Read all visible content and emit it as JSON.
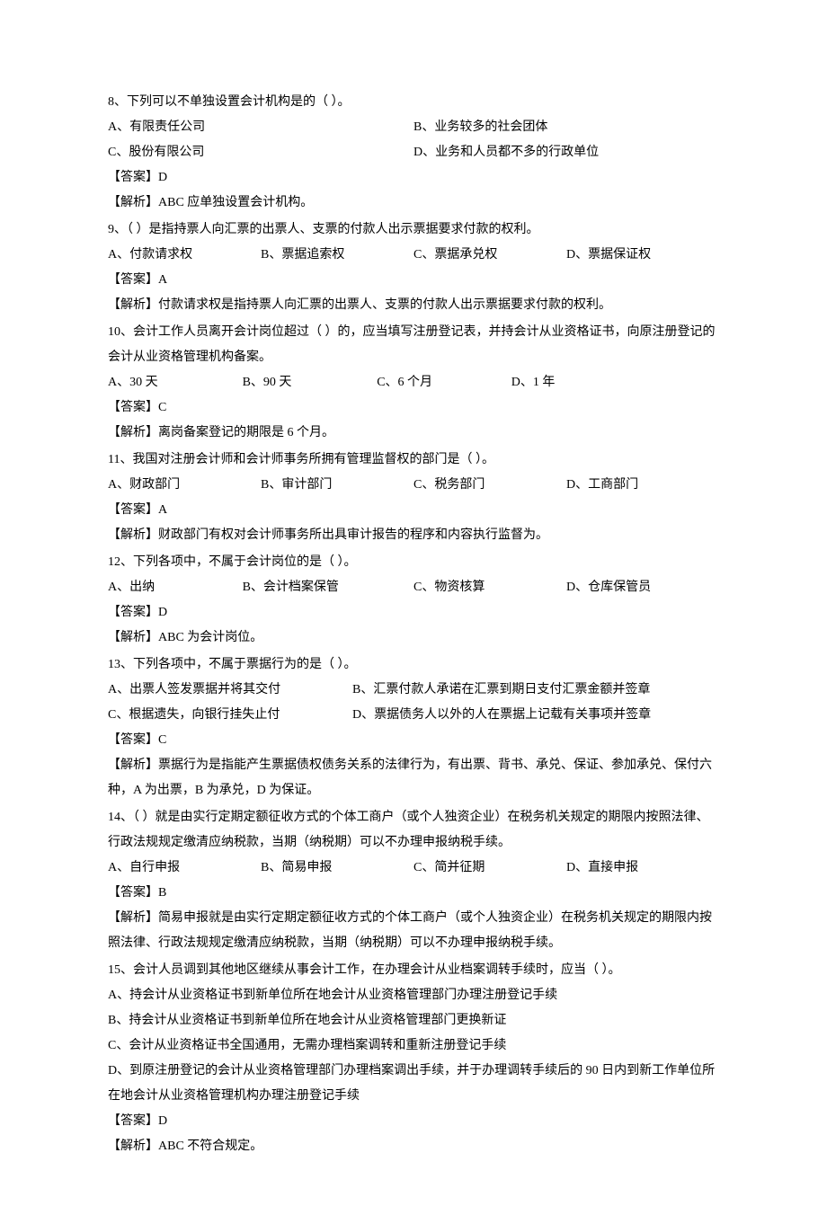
{
  "questions": [
    {
      "num": "8、",
      "text": "下列可以不单独设置会计机构是的（       ）。",
      "options": {
        "A": "A、有限责任公司",
        "B": "B、业务较多的社会团体",
        "C": "C、股份有限公司",
        "D": "D、业务和人员都不多的行政单位"
      },
      "answer": "【答案】D",
      "explain": "【解析】ABC 应单独设置会计机构。"
    },
    {
      "num": "9、",
      "text": "（       ）是指持票人向汇票的出票人、支票的付款人出示票据要求付款的权利。",
      "options": {
        "A": "A、付款请求权",
        "B": "B、票据追索权",
        "C": "C、票据承兑权",
        "D": "D、票据保证权"
      },
      "answer": "【答案】A",
      "explain": "【解析】付款请求权是指持票人向汇票的出票人、支票的付款人出示票据要求付款的权利。"
    },
    {
      "num": "10、",
      "text": "会计工作人员离开会计岗位超过（       ）的，应当填写注册登记表，并持会计从业资格证书，向原注册登记的会计从业资格管理机构备案。",
      "options": {
        "A": "A、30 天",
        "B": "B、90 天",
        "C": "C、6 个月",
        "D": "D、1 年"
      },
      "answer": "【答案】C",
      "explain": "【解析】离岗备案登记的期限是 6 个月。"
    },
    {
      "num": "11、",
      "text": "我国对注册会计师和会计师事务所拥有管理监督权的部门是（       ）。",
      "options": {
        "A": "A、财政部门",
        "B": "B、审计部门",
        "C": "C、税务部门",
        "D": "D、工商部门"
      },
      "answer": "【答案】A",
      "explain": "【解析】财政部门有权对会计师事务所出具审计报告的程序和内容执行监督为。"
    },
    {
      "num": "12、",
      "text": "下列各项中，不属于会计岗位的是（       ）。",
      "options": {
        "A": "A、出纳",
        "B": "B、会计档案保管",
        "C": "C、物资核算",
        "D": "D、仓库保管员"
      },
      "answer": "【答案】D",
      "explain": "【解析】ABC 为会计岗位。"
    },
    {
      "num": "13、",
      "text": "下列各项中，不属于票据行为的是（       ）。",
      "options": {
        "A": "A、出票人签发票据并将其交付",
        "B": "B、汇票付款人承诺在汇票到期日支付汇票金额并签章",
        "C": "C、根据遗失，向银行挂失止付",
        "D": "D、票据债务人以外的人在票据上记载有关事项并签章"
      },
      "answer": "【答案】C",
      "explain": "【解析】票据行为是指能产生票据债权债务关系的法律行为，有出票、背书、承兑、保证、参加承兑、保付六种，A 为出票，B 为承兑，D 为保证。"
    },
    {
      "num": "14、",
      "text": "（       ）就是由实行定期定额征收方式的个体工商户（或个人独资企业）在税务机关规定的期限内按照法律、行政法规规定缴清应纳税款，当期（纳税期）可以不办理申报纳税手续。",
      "options": {
        "A": "A、自行申报",
        "B": "B、简易申报",
        "C": "C、简并征期",
        "D": "D、直接申报"
      },
      "answer": "【答案】B",
      "explain": "【解析】简易申报就是由实行定期定额征收方式的个体工商户（或个人独资企业）在税务机关规定的期限内按照法律、行政法规规定缴清应纳税款，当期（纳税期）可以不办理申报纳税手续。"
    },
    {
      "num": "15、",
      "text": "会计人员调到其他地区继续从事会计工作，在办理会计从业档案调转手续时，应当（       ）。",
      "options": {
        "A": "A、持会计从业资格证书到新单位所在地会计从业资格管理部门办理注册登记手续",
        "B": "B、持会计从业资格证书到新单位所在地会计从业资格管理部门更换新证",
        "C": "C、会计从业资格证书全国通用，无需办理档案调转和重新注册登记手续",
        "D": "D、到原注册登记的会计从业资格管理部门办理档案调出手续，并于办理调转手续后的 90 日内到新工作单位所在地会计从业资格管理机构办理注册登记手续"
      },
      "answer": "【答案】D",
      "explain": "【解析】ABC 不符合规定。"
    }
  ]
}
